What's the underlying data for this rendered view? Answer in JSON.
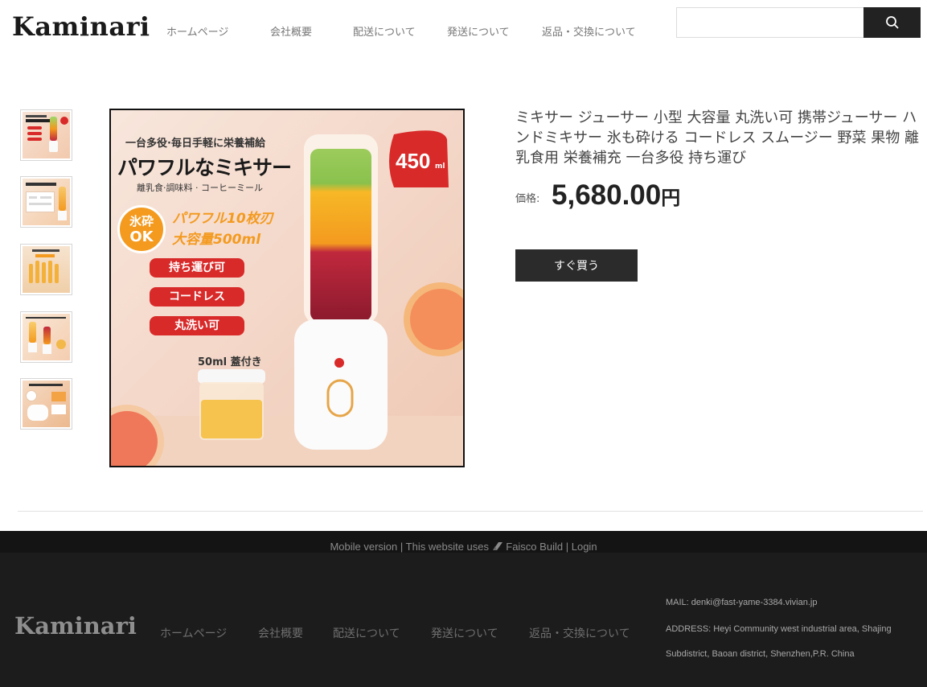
{
  "header": {
    "logo": "Kaminari",
    "nav": [
      "ホームページ",
      "会社概要",
      "配送について",
      "発送について",
      "返品・交換について"
    ],
    "search_placeholder": ""
  },
  "product": {
    "title": "ミキサー ジューサー 小型 大容量 丸洗い可 携帯ジューサー ハンドミキサー 氷も砕ける コードレス スムージー 野菜 果物 離乳食用 栄養補充 一台多役 持ち運び",
    "price_label": "価格:",
    "price": "5,680.00",
    "currency": "円",
    "buy_label": "すぐ買う",
    "image": {
      "top_line": "一台多役·毎日手軽に栄養補給",
      "headline": "パワフルなミキサー",
      "subline": "離乳食·調味料 · コーヒーミール",
      "badge_line1": "氷砕",
      "badge_line2": "OK",
      "power_line1": "パワフル10枚刃",
      "power_line2": "大容量500ml",
      "tags": [
        "持ち運び可",
        "コードレス",
        "丸洗い可"
      ],
      "lid_text": "50ml 蓋付き",
      "capacity": "450",
      "capacity_unit": "ml"
    }
  },
  "footer": {
    "top": {
      "mobile": "Mobile version",
      "sep1": "|",
      "uses": "This website uses",
      "brand": "Faisco",
      "build": "Build",
      "sep2": "|",
      "login": "Login"
    },
    "logo": "Kaminari",
    "nav": [
      "ホームページ",
      "会社概要",
      "配送について",
      "発送について",
      "返品・交換について"
    ],
    "mail": "MAIL:  denki@fast-yame-3384.vivian.jp",
    "address_line1": "ADDRESS:  Heyi Community west industrial area, Shajing",
    "address_line2": "Subdistrict, Baoan district, Shenzhen,P.R. China"
  },
  "colors": {
    "accent_red": "#d92a2a",
    "orange": "#f39a1f",
    "dark": "#222222",
    "footer_bg": "#1c1c1c"
  }
}
